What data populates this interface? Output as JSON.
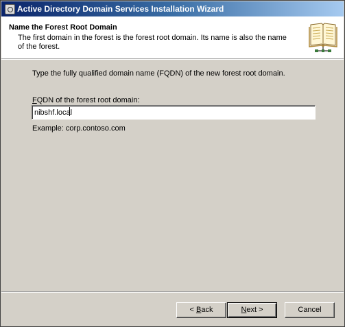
{
  "window": {
    "title": "Active Directory Domain Services Installation Wizard"
  },
  "header": {
    "title": "Name the Forest Root Domain",
    "subtitle": "The first domain in the forest is the forest root domain. Its name is also the name of the forest."
  },
  "main": {
    "instruction": "Type the fully qualified domain name (FQDN) of the new forest root domain.",
    "fqdn_label_first": "F",
    "fqdn_label_rest": "QDN of the forest root domain:",
    "fqdn_value": "nibshf.local",
    "example": "Example: corp.contoso.com"
  },
  "buttons": {
    "back_prefix": "< ",
    "back_access": "B",
    "back_rest": "ack",
    "next_access": "N",
    "next_rest": "ext >",
    "cancel": "Cancel"
  },
  "icons": {
    "window": "wizard-app-icon",
    "header": "book-icon"
  }
}
